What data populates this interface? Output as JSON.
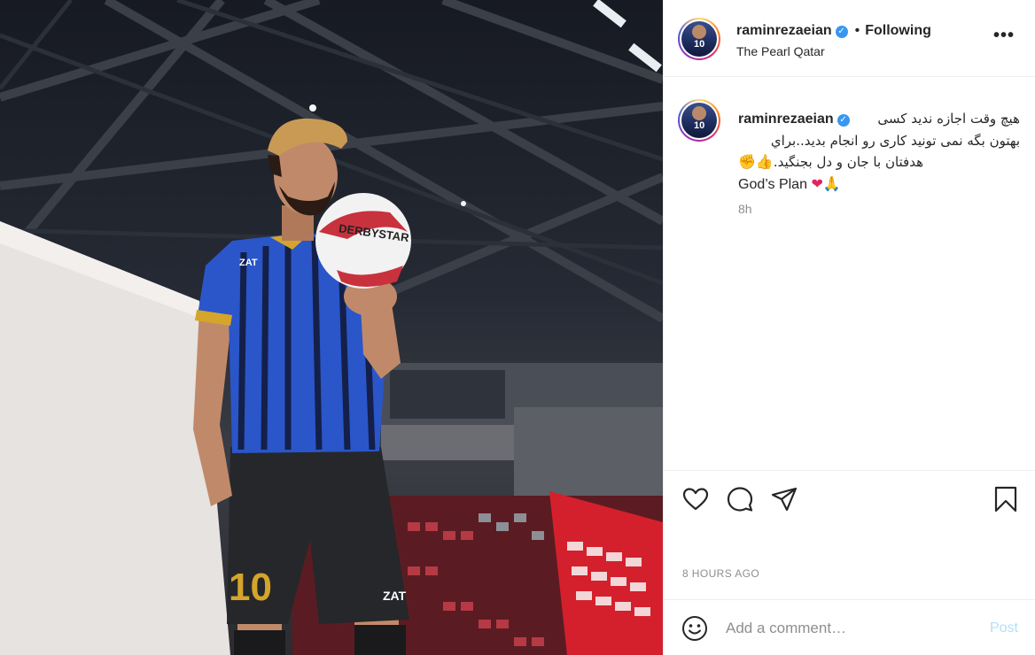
{
  "post": {
    "username": "raminrezaeian",
    "verified_mark": "✓",
    "separator": "•",
    "follow_status": "Following",
    "location": "The Pearl Qatar",
    "more_label": "•••",
    "avatar_number": "10",
    "photo": {
      "ball_brand": "DERBYSTAR",
      "jersey_number": "10",
      "shirt_logo": "ZAT"
    }
  },
  "caption": {
    "username": "raminrezaeian",
    "line1_rtl": "هیچ وقت اجازه ندید کسی",
    "line2_rtl": "بهتون بگه نمی تونید کاری رو انجام بدید..براي",
    "line3_rtl": "هدفتان با جان و دل بجنگید.",
    "line3_emojis": "✊👍",
    "line4": "God’s Plan",
    "line4_emojis": "❤🙏",
    "time_ago": "8h"
  },
  "actions": {
    "like_icon": "heart-icon",
    "comment_icon": "comment-icon",
    "share_icon": "share-icon",
    "save_icon": "bookmark-icon"
  },
  "timestamp": "8 HOURS AGO",
  "comment_box": {
    "emoji_icon": "smile-icon",
    "placeholder": "Add a comment…",
    "post_label": "Post",
    "post_color": "#b2dffc"
  },
  "colors": {
    "verified": "#3897f0",
    "text": "#262626",
    "secondary": "#8e8e8e",
    "jersey_blue": "#2a56c9",
    "jersey_gold": "#d4a52a"
  }
}
